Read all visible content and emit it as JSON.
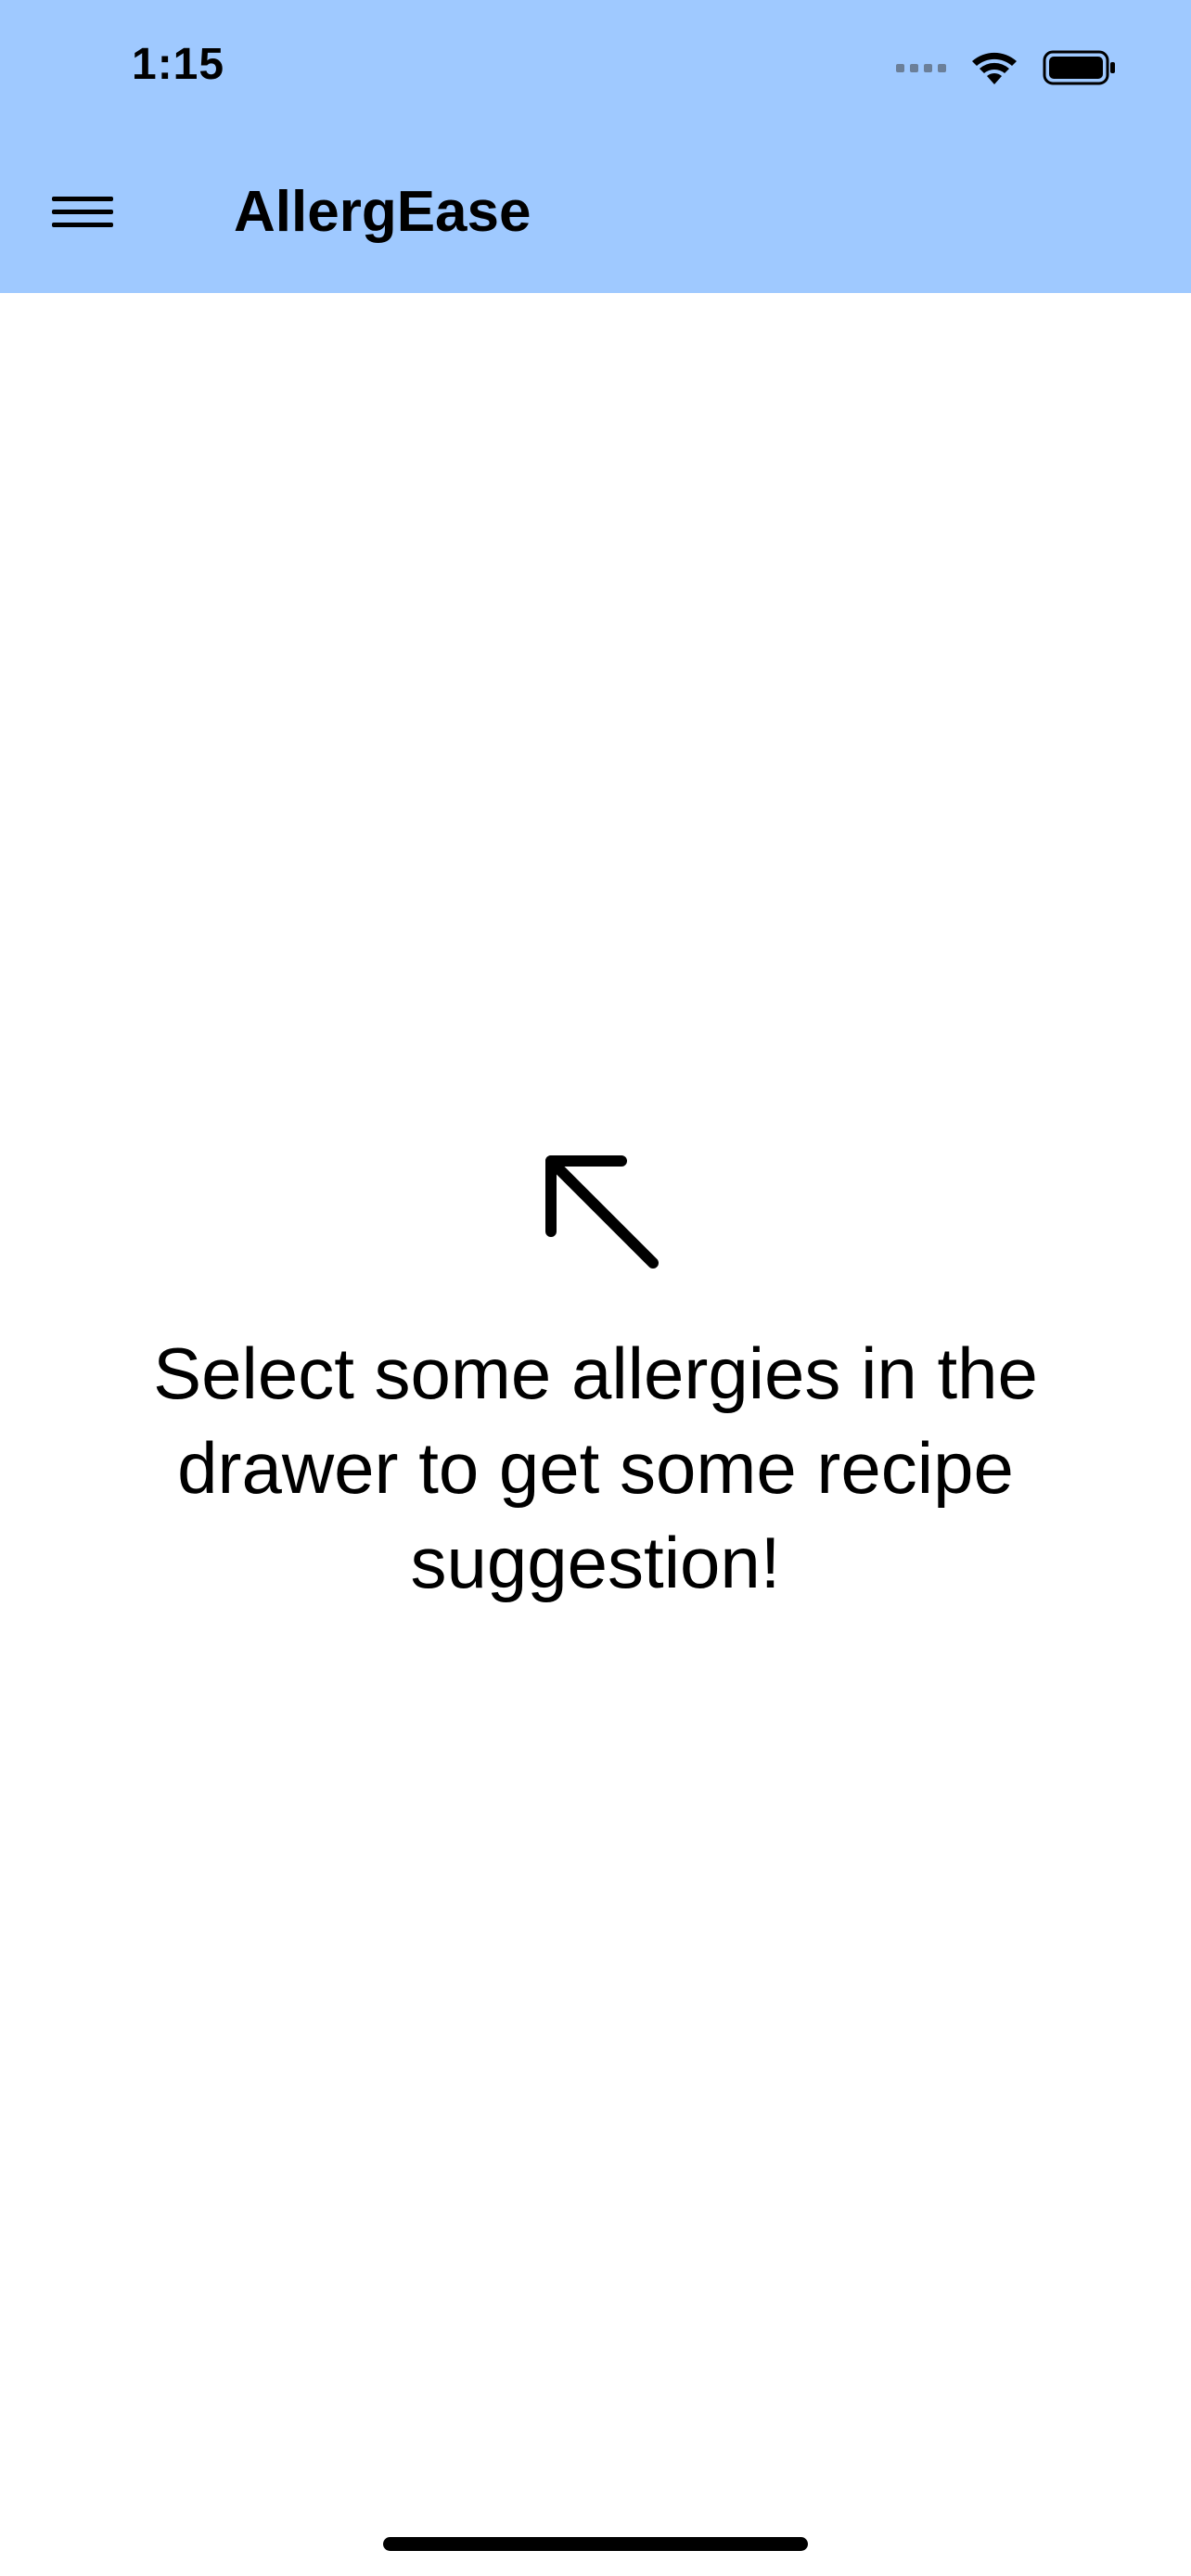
{
  "status_bar": {
    "time": "1:15",
    "icons": [
      "cellular-signal-icon",
      "wifi-icon",
      "battery-icon"
    ]
  },
  "app_bar": {
    "menu_icon": "hamburger-menu-icon",
    "title": "AllergEase",
    "background_color": "#9fc9ff"
  },
  "empty_state": {
    "icon": "arrow-up-left-icon",
    "message": "Select some allergies in the drawer to get some recipe suggestion!"
  }
}
